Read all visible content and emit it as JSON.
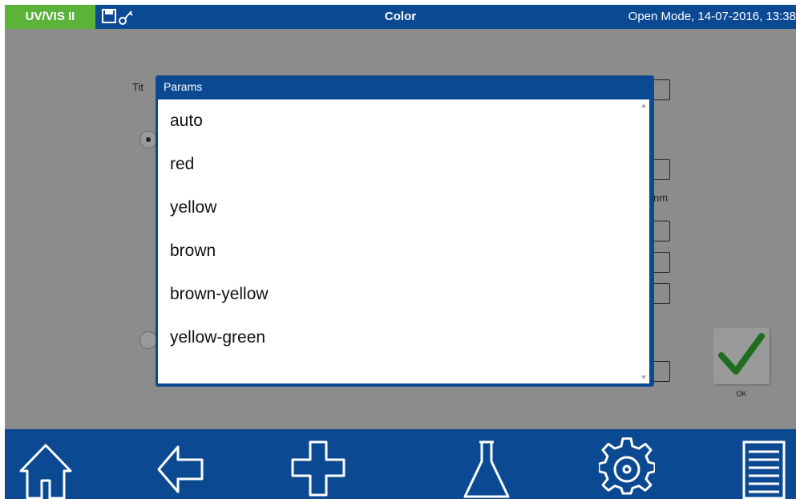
{
  "app": {
    "brand": "UV/VIS II",
    "title": "Color",
    "status": "Open Mode, 14-07-2016, 13:38"
  },
  "toolbar_icons": [
    "save-icon",
    "key-icon"
  ],
  "background_form": {
    "title_label_fragment": "Tit",
    "unit_fragment": "nm"
  },
  "modal": {
    "title": "Params",
    "items": [
      "auto",
      "red",
      "yellow",
      "brown",
      "brown-yellow",
      "yellow-green"
    ]
  },
  "ok_button": {
    "label": "OK"
  },
  "bottom_nav": [
    "home-icon",
    "back-arrow-icon",
    "plus-icon",
    "flask-icon",
    "gear-icon",
    "list-icon"
  ],
  "colors": {
    "bar_blue": "#0b4a93",
    "brand_green": "#5cb33a",
    "check_green": "#1f6e1f",
    "overlay_gray": "#8c8c8c"
  }
}
